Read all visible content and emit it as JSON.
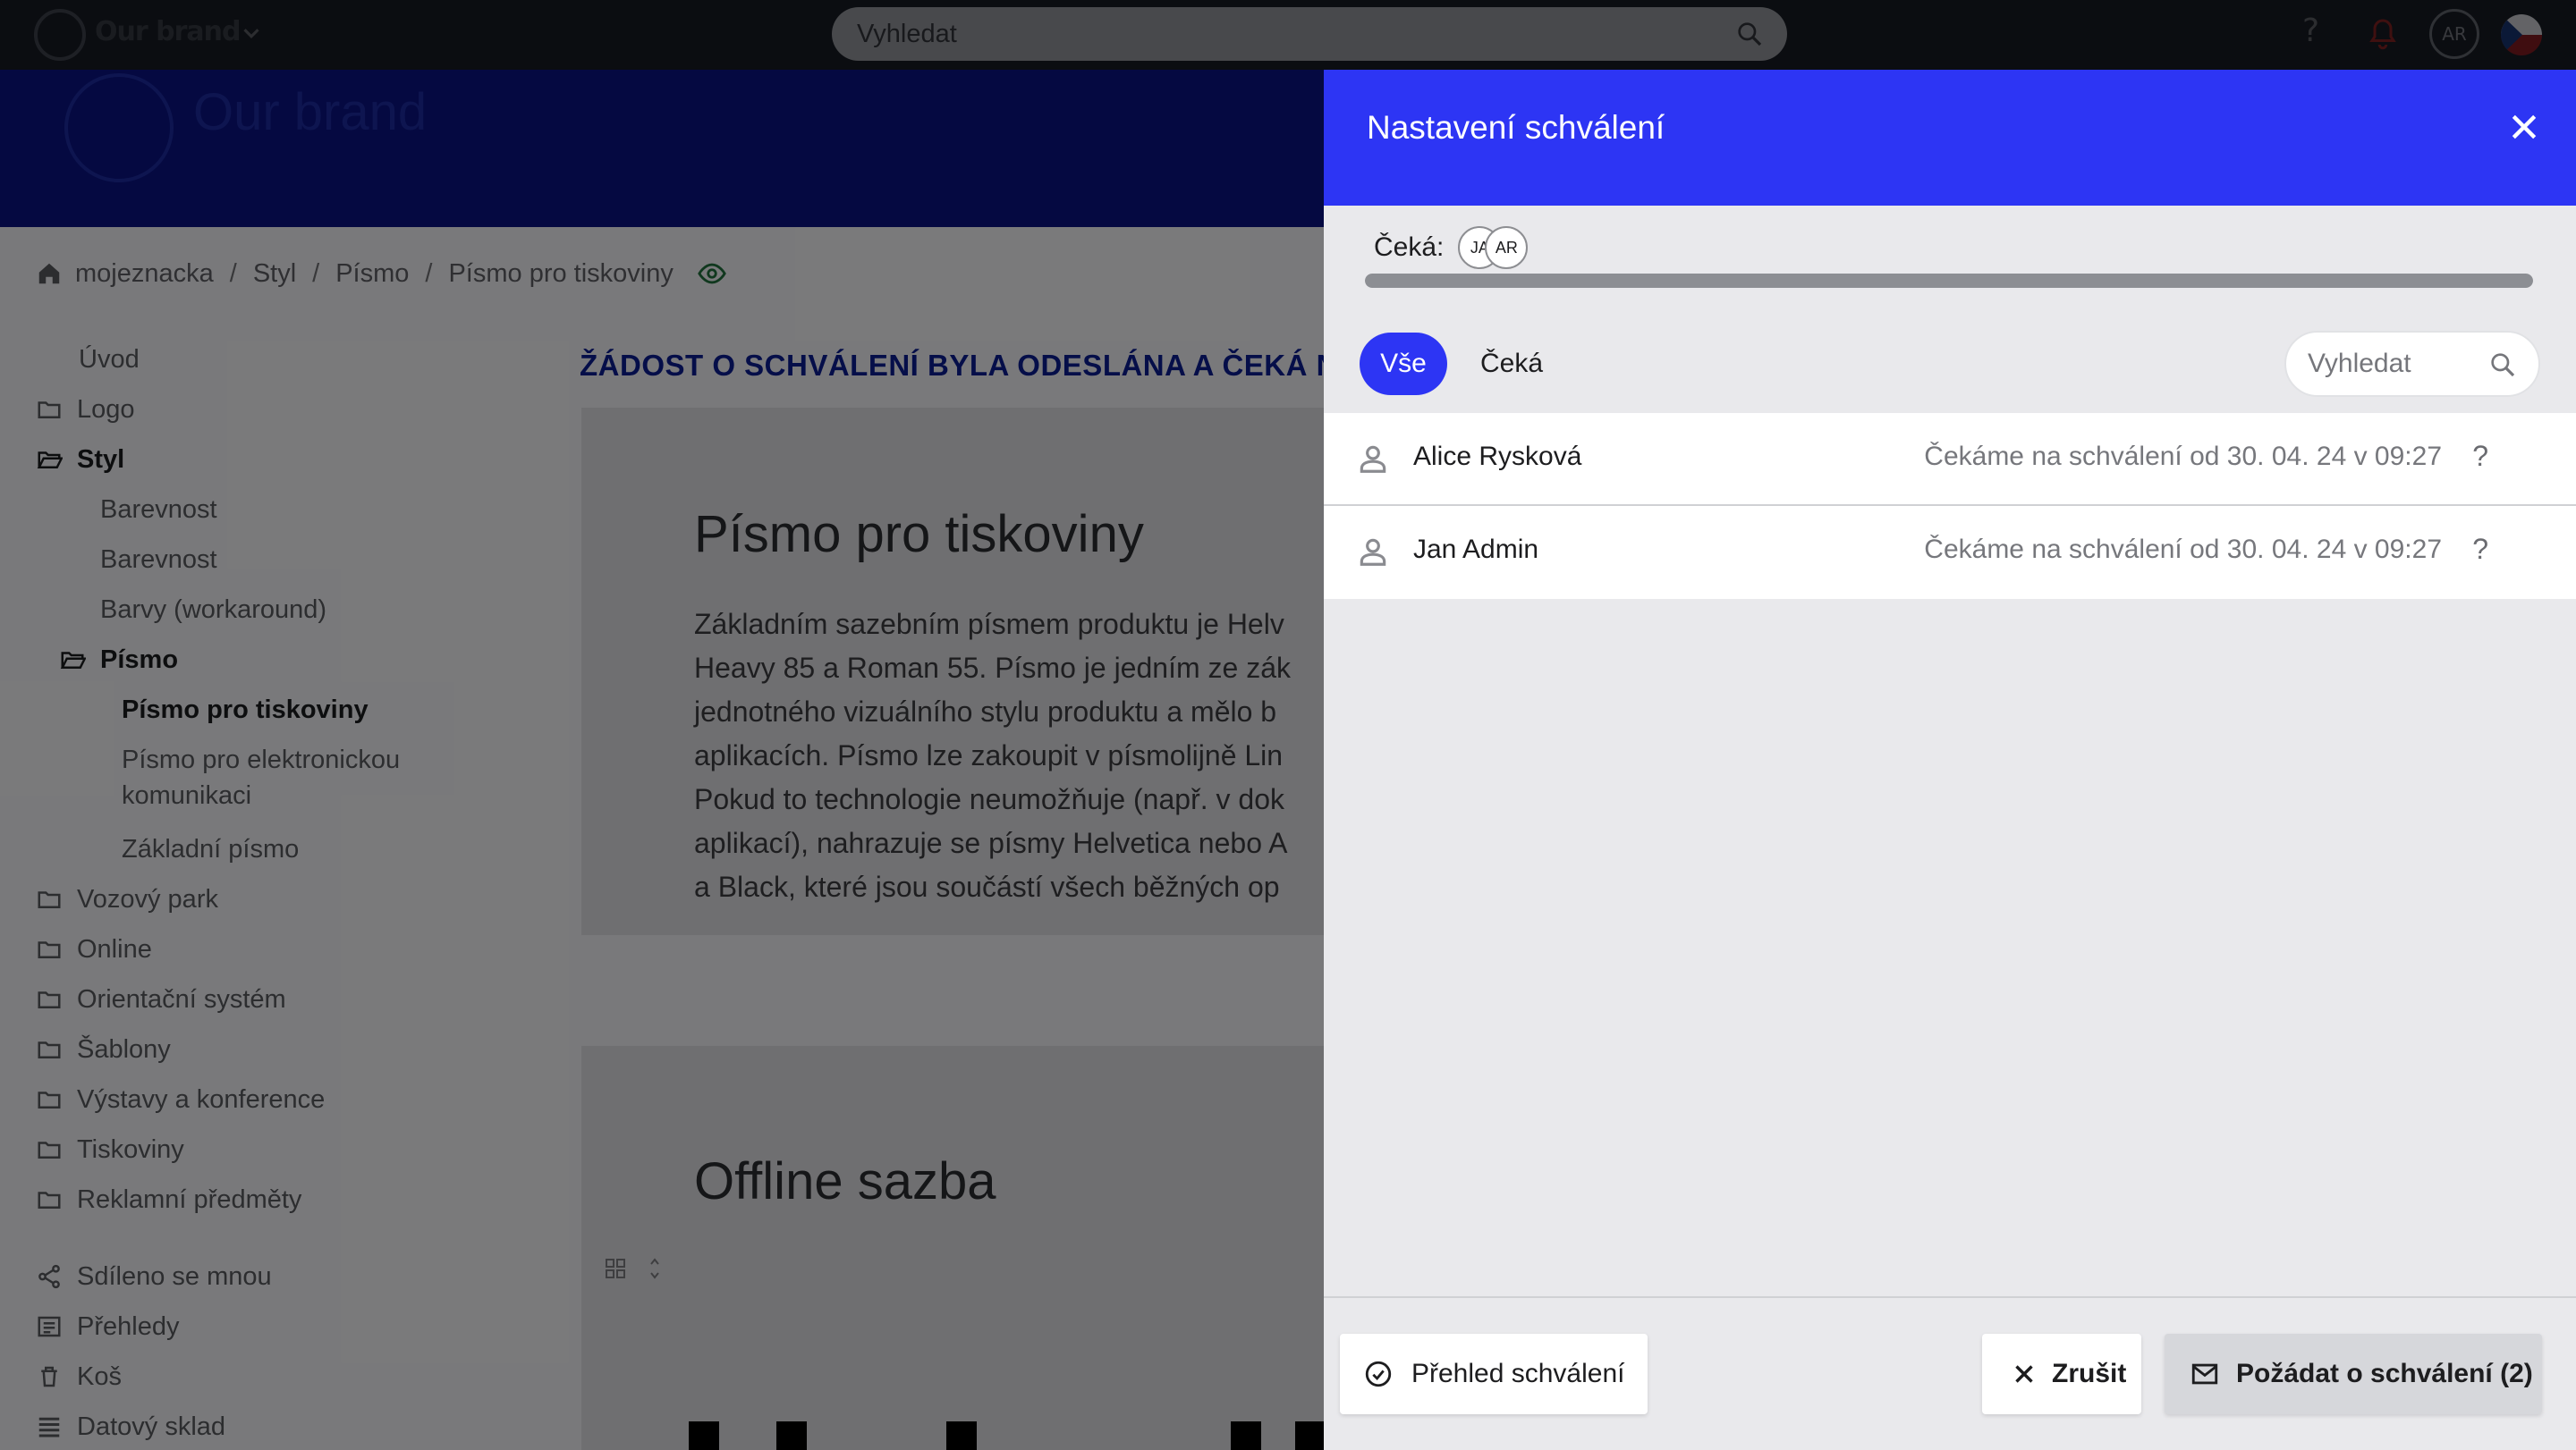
{
  "app": {
    "brand": "Our brand",
    "search_placeholder": "Vyhledat",
    "help_label": "?",
    "user_initials": "AR"
  },
  "breadcrumb": [
    "mojeznacka",
    "/",
    "Styl",
    "/",
    "Písmo",
    "/",
    "Písmo pro tiskoviny"
  ],
  "sidebar": {
    "items": [
      {
        "label": "Úvod",
        "icon": "none",
        "level": 0
      },
      {
        "label": "Logo",
        "icon": "folder-icon",
        "level": 0
      },
      {
        "label": "Styl",
        "icon": "folder-open-icon",
        "level": 0,
        "bold": true
      },
      {
        "label": "Barevnost",
        "icon": "none",
        "level": 1
      },
      {
        "label": "Barevnost",
        "icon": "none",
        "level": 1
      },
      {
        "label": "Barvy (workaround)",
        "icon": "none",
        "level": 1
      },
      {
        "label": "Písmo",
        "icon": "folder-open-icon",
        "level": 1,
        "bold": true
      },
      {
        "label": "Písmo pro tiskoviny",
        "icon": "none",
        "level": 2,
        "bold": true
      },
      {
        "label": "Písmo pro elektronickou",
        "icon": "none",
        "level": 2
      },
      {
        "label": "komunikaci",
        "icon": "none",
        "level": 2
      },
      {
        "label": "Základní písmo",
        "icon": "none",
        "level": 2
      },
      {
        "label": "Vozový park",
        "icon": "folder-icon",
        "level": 0
      },
      {
        "label": "Online",
        "icon": "folder-icon",
        "level": 0
      },
      {
        "label": "Orientační systém",
        "icon": "folder-icon",
        "level": 0
      },
      {
        "label": "Šablony",
        "icon": "folder-icon",
        "level": 0
      },
      {
        "label": "Výstavy a konference",
        "icon": "folder-icon",
        "level": 0
      },
      {
        "label": "Tiskoviny",
        "icon": "folder-icon",
        "level": 0
      },
      {
        "label": "Reklamní předměty",
        "icon": "folder-icon",
        "level": 0
      },
      {
        "label": "Sdíleno se mnou",
        "icon": "share-icon",
        "level": 0
      },
      {
        "label": "Přehledy",
        "icon": "overview-icon",
        "level": 0
      },
      {
        "label": "Koš",
        "icon": "trash-icon",
        "level": 0
      },
      {
        "label": "Datový sklad",
        "icon": "storage-icon",
        "level": 0
      }
    ]
  },
  "content": {
    "alert": "ŽÁDOST O SCHVÁLENÍ BYLA ODESLÁNA A ČEKÁ NA V",
    "heading": "Písmo pro tiskoviny",
    "paragraph_lines": [
      "Základním sazebním písmem produktu je Helv",
      "Heavy 85 a Roman 55. Písmo je jedním ze zák",
      "jednotného vizuálního stylu produktu a mělo b",
      "aplikacích. Písmo lze zakoupit v písmolijně Lin",
      "Pokud to technologie neumožňuje (např. v dok",
      "aplikací), nahrazuje se písmy Helvetica nebo A",
      "a Black, které jsou součástí všech běžných op"
    ],
    "section2_heading": "Offline sazba"
  },
  "drawer": {
    "title": "Nastavení schválení",
    "waiting_label": "Čeká:",
    "waiting_avatars": [
      "JA",
      "AR"
    ],
    "progress": 1.0,
    "tabs": [
      "Vše",
      "Čeká"
    ],
    "active_tab": "Vše",
    "search_placeholder": "Vyhledat",
    "approvers": [
      {
        "name": "Alice Rysková",
        "status": "Čekáme na schválení od 30. 04. 24 v 09:27",
        "help": "?"
      },
      {
        "name": "Jan Admin",
        "status": "Čekáme na schválení od 30. 04. 24 v 09:27",
        "help": "?"
      }
    ],
    "buttons": {
      "overview": "Přehled schválení",
      "cancel": "Zrušit",
      "request": "Požádat o schválení (2)"
    }
  },
  "colors": {
    "accent": "#2d35f4",
    "topbar": "#161a22",
    "banner": "#0a137e"
  }
}
